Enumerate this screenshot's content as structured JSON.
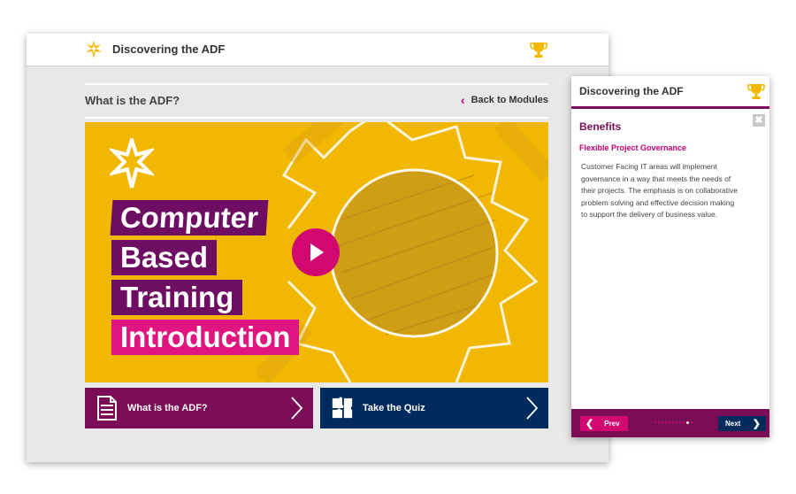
{
  "main": {
    "app_title": "Discovering the ADF",
    "section_title": "What is the ADF?",
    "back_label": "Back to Modules",
    "hero": {
      "lines": [
        "Computer",
        "Based",
        "Training",
        "Introduction"
      ]
    },
    "buttons": [
      {
        "label": "What is the ADF?",
        "icon": "document-icon",
        "color": "#7b0c56"
      },
      {
        "label": "Take the Quiz",
        "icon": "puzzle-icon",
        "color": "#002b5c"
      }
    ]
  },
  "panel": {
    "title": "Discovering the ADF",
    "close_label": "✖",
    "heading": "Benefits",
    "subheading": "Flexible Project Governance",
    "body": "Customer Facing IT areas will implement governance in a way that meets the needs of their projects. The emphasis is on collaborative problem solving and effective decision making to support the delivery of business value.",
    "prev_label": "Prev",
    "next_label": "Next",
    "pagination": {
      "total": 11,
      "current": 10
    }
  },
  "colors": {
    "brand_purple": "#7b0c56",
    "brand_magenta": "#d1086f",
    "navy": "#002b5c",
    "hero_yellow": "#f2b700",
    "trophy_gold": "#f2b700"
  }
}
